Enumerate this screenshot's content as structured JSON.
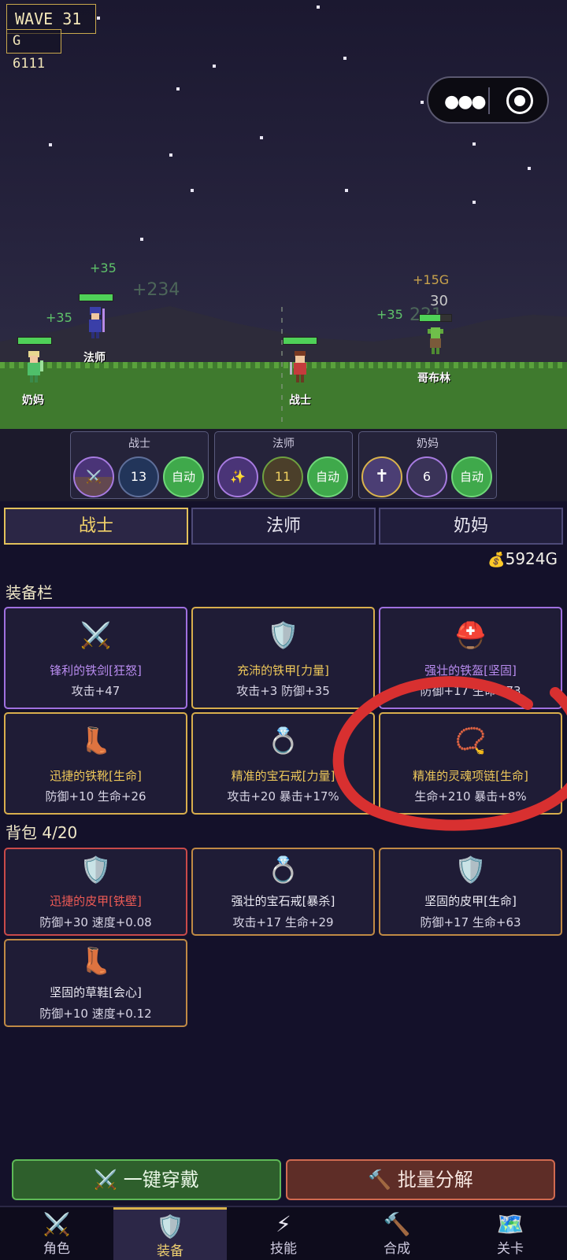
{
  "hud": {
    "wave": "WAVE  31",
    "gold": "G 6111"
  },
  "scene": {
    "floating": [
      "+35",
      "+234",
      "+35",
      "+15G",
      "30",
      "+35",
      "221"
    ],
    "units": {
      "healer": "奶妈",
      "mage": "法师",
      "warrior": "战士",
      "goblin": "哥布林"
    }
  },
  "skill_groups": [
    {
      "title": "战士",
      "skills": [
        {
          "icon": "sword"
        },
        {
          "icon": "shield",
          "value": "13"
        },
        {
          "label": "自动"
        }
      ]
    },
    {
      "title": "法师",
      "skills": [
        {
          "icon": "sparkle"
        },
        {
          "icon": "bolt",
          "value": "11"
        },
        {
          "label": "自动"
        }
      ]
    },
    {
      "title": "奶妈",
      "skills": [
        {
          "icon": "cross"
        },
        {
          "icon": "sprout",
          "value": "6"
        },
        {
          "label": "自动"
        }
      ]
    }
  ],
  "tabs": [
    "战士",
    "法师",
    "奶妈"
  ],
  "active_tab": "战士",
  "gold_total": "5924G",
  "equipped": {
    "title": "装备栏",
    "items": [
      {
        "icon": "sword",
        "name": "锋利的铁剑[狂怒]",
        "stats": "攻击+47",
        "rarity": "epic"
      },
      {
        "icon": "shield",
        "name": "充沛的铁甲[力量]",
        "stats": "攻击+3 防御+35",
        "rarity": "legendary"
      },
      {
        "icon": "helmet",
        "name": "强壮的铁盔[坚固]",
        "stats": "防御+17 生命+73",
        "rarity": "epic"
      },
      {
        "icon": "boot",
        "name": "迅捷的铁靴[生命]",
        "stats": "防御+10 生命+26",
        "rarity": "legendary"
      },
      {
        "icon": "ring",
        "name": "精准的宝石戒[力量]",
        "stats": "攻击+20 暴击+17%",
        "rarity": "legendary"
      },
      {
        "icon": "necklace",
        "name": "精准的灵魂项链[生命]",
        "stats": "生命+210 暴击+8%",
        "rarity": "legendary"
      }
    ]
  },
  "backpack": {
    "title": "背包 4/20",
    "items": [
      {
        "icon": "shield",
        "name": "迅捷的皮甲[铁壁]",
        "stats": "防御+30 速度+0.08",
        "rarity": "red"
      },
      {
        "icon": "ring",
        "name": "强壮的宝石戒[暴杀]",
        "stats": "攻击+17 生命+29",
        "rarity": "orange"
      },
      {
        "icon": "shield",
        "name": "坚固的皮甲[生命]",
        "stats": "防御+17 生命+63",
        "rarity": "orange"
      },
      {
        "icon": "boot",
        "name": "坚固的草鞋[会心]",
        "stats": "防御+10 速度+0.12",
        "rarity": "orange"
      }
    ]
  },
  "actions": {
    "equip_all": "⚔️ 一键穿戴",
    "disassemble": "🔨 批量分解"
  },
  "nav": [
    {
      "icon": "sword",
      "label": "角色"
    },
    {
      "icon": "shield",
      "label": "装备"
    },
    {
      "icon": "bolt",
      "label": "技能"
    },
    {
      "icon": "hammer",
      "label": "合成"
    },
    {
      "icon": "map",
      "label": "关卡"
    }
  ],
  "active_nav": "装备",
  "colors": {
    "epic": "#a070e0",
    "legendary": "#d8ae4d",
    "red": "#c94a4a",
    "heal_text": "#5fc36a",
    "gold_text": "#c8a24c"
  }
}
